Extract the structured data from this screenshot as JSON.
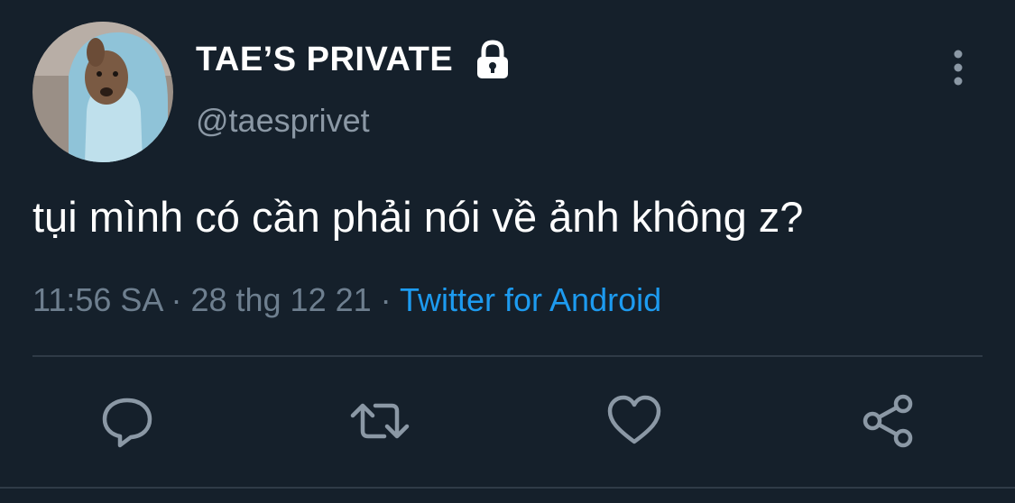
{
  "tweet": {
    "display_name": "TAE’S PRIVATE",
    "handle": "@taesprivet",
    "text": "tụi mình có cần phải nói về ảnh không z?",
    "time": "11:56 SA",
    "date": "28 thg 12 21",
    "separator": " · ",
    "source": "Twitter for Android",
    "account_locked": true
  },
  "icons": {
    "avatar": "avatar-dog-hoodie",
    "lock": "lock-icon",
    "more": "vertical-ellipsis-icon",
    "reply": "reply-bubble-icon",
    "retweet": "retweet-icon",
    "like": "heart-icon",
    "share": "share-icon"
  },
  "colors": {
    "background": "#15202b",
    "text_primary": "#ffffff",
    "text_secondary": "#8b98a5",
    "link": "#1d9bf0",
    "divider": "#2f3b47",
    "icon": "#8b98a5"
  }
}
